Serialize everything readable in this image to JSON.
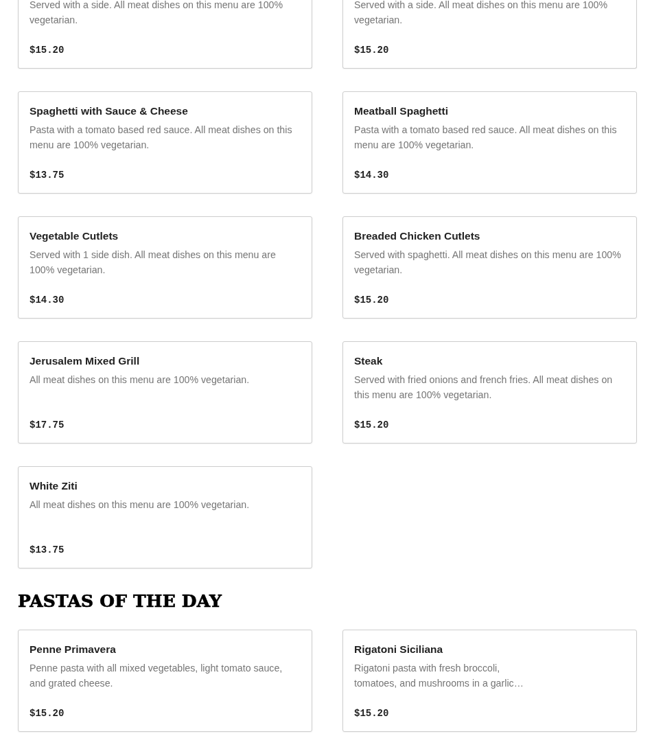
{
  "sections": [
    {
      "items": [
        {
          "description": "Served with a side. All meat dishes on this menu are 100% vegetarian.",
          "price": "$15.20"
        },
        {
          "description": "Served with a side. All meat dishes on this menu are 100% vegetarian.",
          "price": "$15.20"
        },
        {
          "name": "Spaghetti with Sauce & Cheese",
          "description": "Pasta with a tomato based red sauce. All meat dishes on this menu are 100% vegetarian.",
          "price": "$13.75"
        },
        {
          "name": "Meatball Spaghetti",
          "description": "Pasta with a tomato based red sauce. All meat dishes on this menu are 100% vegetarian.",
          "price": "$14.30"
        },
        {
          "name": "Vegetable Cutlets",
          "description": "Served with 1 side dish. All meat dishes on this menu are 100% vegetarian.",
          "price": "$14.30"
        },
        {
          "name": "Breaded Chicken Cutlets",
          "description": "Served with spaghetti. All meat dishes on this menu are 100% vegetarian.",
          "price": "$15.20"
        },
        {
          "name": "Jerusalem Mixed Grill",
          "description": "All meat dishes on this menu are 100% vegetarian.",
          "price": "$17.75"
        },
        {
          "name": "Steak",
          "description": "Served with fried onions and french fries. All meat dishes on this menu are 100% vegetarian.",
          "price": "$15.20"
        },
        {
          "name": "White Ziti",
          "description": "All meat dishes on this menu are 100% vegetarian.",
          "price": "$13.75"
        }
      ]
    },
    {
      "title": "PASTAS OF THE DAY",
      "items": [
        {
          "name": "Penne Primavera",
          "description": "Penne pasta with all mixed vegetables, light tomato sauce, and grated cheese.",
          "price": "$15.20"
        },
        {
          "name": "Rigatoni Siciliana",
          "description": "Rigatoni pasta with fresh broccoli,\ntomatoes, and mushrooms in a garlic…",
          "price": "$15.20"
        }
      ]
    }
  ]
}
